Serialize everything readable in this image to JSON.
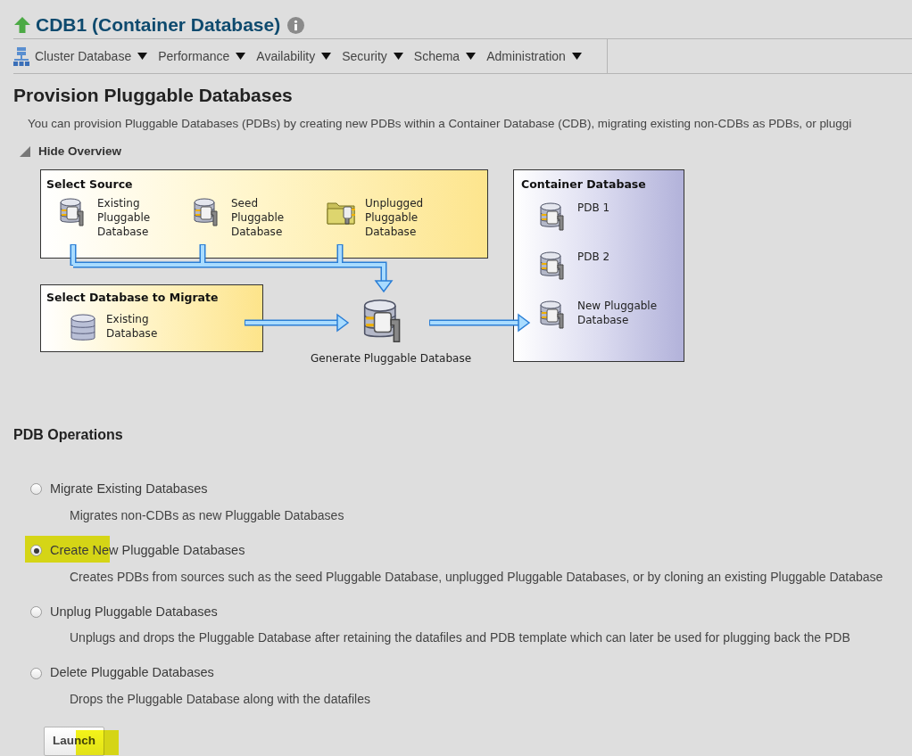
{
  "header": {
    "title": "CDB1 (Container Database)"
  },
  "nav": [
    {
      "label": "Cluster Database"
    },
    {
      "label": "Performance"
    },
    {
      "label": "Availability"
    },
    {
      "label": "Security"
    },
    {
      "label": "Schema"
    },
    {
      "label": "Administration"
    }
  ],
  "page_title": "Provision Pluggable Databases",
  "intro": "You can provision Pluggable Databases (PDBs) by creating new PDBs within a Container Database (CDB), migrating existing non-CDBs as PDBs, or pluggi",
  "overview_toggle": {
    "label": "Hide Overview",
    "expanded": true
  },
  "diagram": {
    "source": {
      "title": "Select Source",
      "items": [
        {
          "kind": "pdb",
          "lines": [
            "Existing",
            "Pluggable",
            "Database"
          ]
        },
        {
          "kind": "pdb",
          "lines": [
            "Seed",
            "Pluggable",
            "Database"
          ]
        },
        {
          "kind": "unplugged",
          "lines": [
            "Unplugged",
            "Pluggable",
            "Database"
          ]
        }
      ]
    },
    "migrate": {
      "title": "Select Database to Migrate",
      "items": [
        {
          "kind": "database",
          "lines": [
            "Existing",
            "Database"
          ]
        }
      ]
    },
    "generate": {
      "label": "Generate Pluggable Database"
    },
    "container": {
      "title": "Container Database",
      "items": [
        {
          "kind": "pdb",
          "lines": [
            "PDB 1"
          ]
        },
        {
          "kind": "pdb",
          "lines": [
            "PDB 2"
          ]
        },
        {
          "kind": "pdb",
          "lines": [
            "New Pluggable",
            "Database"
          ]
        }
      ]
    }
  },
  "operations_title": "PDB Operations",
  "operations": [
    {
      "label": "Migrate Existing Databases",
      "description": "Migrates non-CDBs as new Pluggable Databases",
      "selected": false,
      "highlighted": false
    },
    {
      "label": "Create New Pluggable Databases",
      "description": "Creates PDBs from sources such as the seed Pluggable Database, unplugged Pluggable Databases, or by cloning an existing Pluggable Database",
      "selected": true,
      "highlighted": true
    },
    {
      "label": "Unplug Pluggable Databases",
      "description": "Unplugs and drops the Pluggable Database after retaining the datafiles and PDB template which can later be used for plugging back the PDB",
      "selected": false,
      "highlighted": false
    },
    {
      "label": "Delete Pluggable Databases",
      "description": "Drops the Pluggable Database along with the datafiles",
      "selected": false,
      "highlighted": false
    }
  ],
  "launch": {
    "label": "Launch",
    "highlighted": true
  }
}
